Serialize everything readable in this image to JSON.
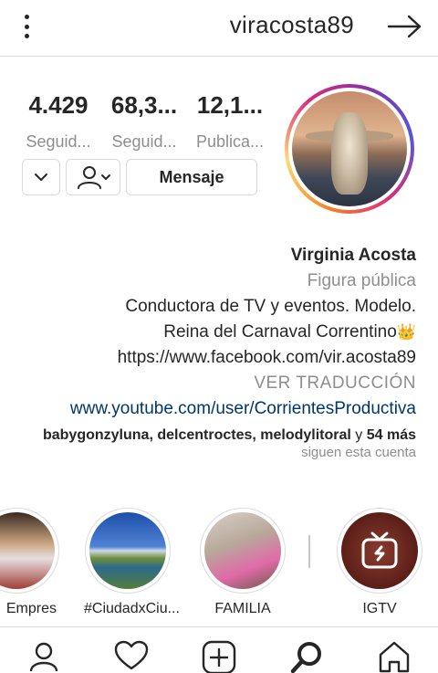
{
  "header": {
    "username": "viracosta89",
    "menu_icon": "three-dots-vertical-icon",
    "nav_icon": "arrow-right-icon"
  },
  "stats": [
    {
      "value": "4.429",
      "label": "Seguid..."
    },
    {
      "value": "68,3...",
      "label": "Seguid..."
    },
    {
      "value": "12,1...",
      "label": "Publica..."
    }
  ],
  "actions": {
    "message_label": "Mensaje",
    "follow_icon": "person-following-icon",
    "chevron_icon": "chevron-down-icon"
  },
  "bio": {
    "name": "Virginia Acosta",
    "category": "Figura pública",
    "line1": "Conductora de TV y eventos. Modelo.",
    "line2": "Reina del Carnaval Correntino",
    "crown": "👑",
    "line3": "https://www.facebook.com/vir.acosta89",
    "see_translation": "VER TRADUCCIÓN",
    "website": "www.youtube.com/user/CorrientesProductiva",
    "followed_by_names": "babygonzyluna, delcentroctes, melodylitoral",
    "followed_by_and": " y ",
    "followed_by_more": "54 más",
    "followed_by_sub": "siguen esta cuenta"
  },
  "highlights": [
    {
      "label": "IGTV"
    },
    {
      "label": "FAMILIA"
    },
    {
      "label": "#CiudadxCiu..."
    },
    {
      "label": "Empres"
    }
  ],
  "bottom_nav": {
    "items": [
      "profile-icon",
      "heart-icon",
      "add-post-icon",
      "search-icon",
      "home-icon"
    ]
  },
  "colors": {
    "text": "#262626",
    "secondary": "#8e8e8e",
    "link": "#00376b",
    "border": "#dbdbdb"
  }
}
